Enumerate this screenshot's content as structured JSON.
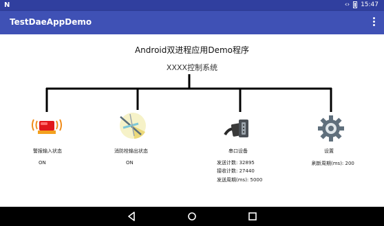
{
  "status_bar": {
    "left_glyph": "N",
    "time": "15:47",
    "icons": [
      "sync-arrows-icon",
      "battery-icon"
    ]
  },
  "app_bar": {
    "title": "TestDaeAppDemo",
    "overflow_icon": "more-vert-icon"
  },
  "main": {
    "title": "Android双进程应用Demo程序",
    "subtitle": "XXXX控制系统",
    "modules": [
      {
        "icon": "alarm-siren-icon",
        "label": "警报输入状态",
        "lines": [
          "ON"
        ]
      },
      {
        "icon": "fire-hydrant-icon",
        "label": "消防栓输出状态",
        "lines": [
          "ON"
        ]
      },
      {
        "icon": "serial-port-icon",
        "label": "串口设备",
        "lines": [
          "发送计数: 32895",
          "接收计数: 27440",
          "发送周期(ms): 5000"
        ]
      },
      {
        "icon": "gear-icon",
        "label": "设置",
        "lines": [
          "刷新周期(ms): 200"
        ]
      }
    ]
  },
  "nav_bar": {
    "buttons": [
      "back-icon",
      "home-icon",
      "recents-icon"
    ]
  },
  "colors": {
    "status_bar": "#303f9f",
    "app_bar": "#3f51b5",
    "nav_bar": "#000000",
    "tree_line": "#000000"
  }
}
